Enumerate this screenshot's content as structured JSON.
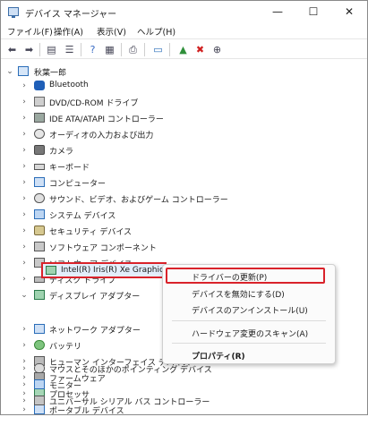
{
  "window": {
    "title": "デバイス マネージャー",
    "controls": {
      "minimize": "—",
      "maximize": "☐",
      "close": "✕"
    }
  },
  "menu": [
    "ファイル(F)",
    "操作(A)",
    "表示(V)",
    "ヘルプ(H)"
  ],
  "toolbar": [
    "back-icon",
    "forward-icon",
    "properties-icon",
    "list-icon",
    "help-icon",
    "details-icon",
    "print-icon",
    "monitor-icon",
    "update-driver-icon",
    "uninstall-icon",
    "download-icon"
  ],
  "tree": {
    "root": "秋葉一郎",
    "items": [
      "Bluetooth",
      "DVD/CD-ROM ドライブ",
      "IDE ATA/ATAPI コントローラー",
      "オーディオの入力および出力",
      "カメラ",
      "キーボード",
      "コンピューター",
      "サウンド、ビデオ、およびゲーム コントローラー",
      "システム デバイス",
      "セキュリティ デバイス",
      "ソフトウェア コンポーネント",
      "ソフトウェア デバイス",
      "ディスク ドライブ",
      "ディスプレイ アダプター",
      "Intel(R) Iris(R) Xe Graphics",
      "ネットワーク アダプター",
      "バッテリ",
      "ヒューマン インターフェイス デバイス",
      "ファームウェア",
      "プロセッサ",
      "ポータブル デバイス",
      "マウスとそのほかのポインティング デバイス",
      "モニター",
      "ユニバーサル シリアル バス コントローラー"
    ]
  },
  "context_menu": {
    "items": [
      "ドライバーの更新(P)",
      "デバイスを無効にする(D)",
      "デバイスのアンインストール(U)",
      "ハードウェア変更のスキャン(A)",
      "プロパティ(R)"
    ]
  },
  "colors": {
    "highlight_border": "#d9222a",
    "selection_bg": "#e3eefb"
  }
}
